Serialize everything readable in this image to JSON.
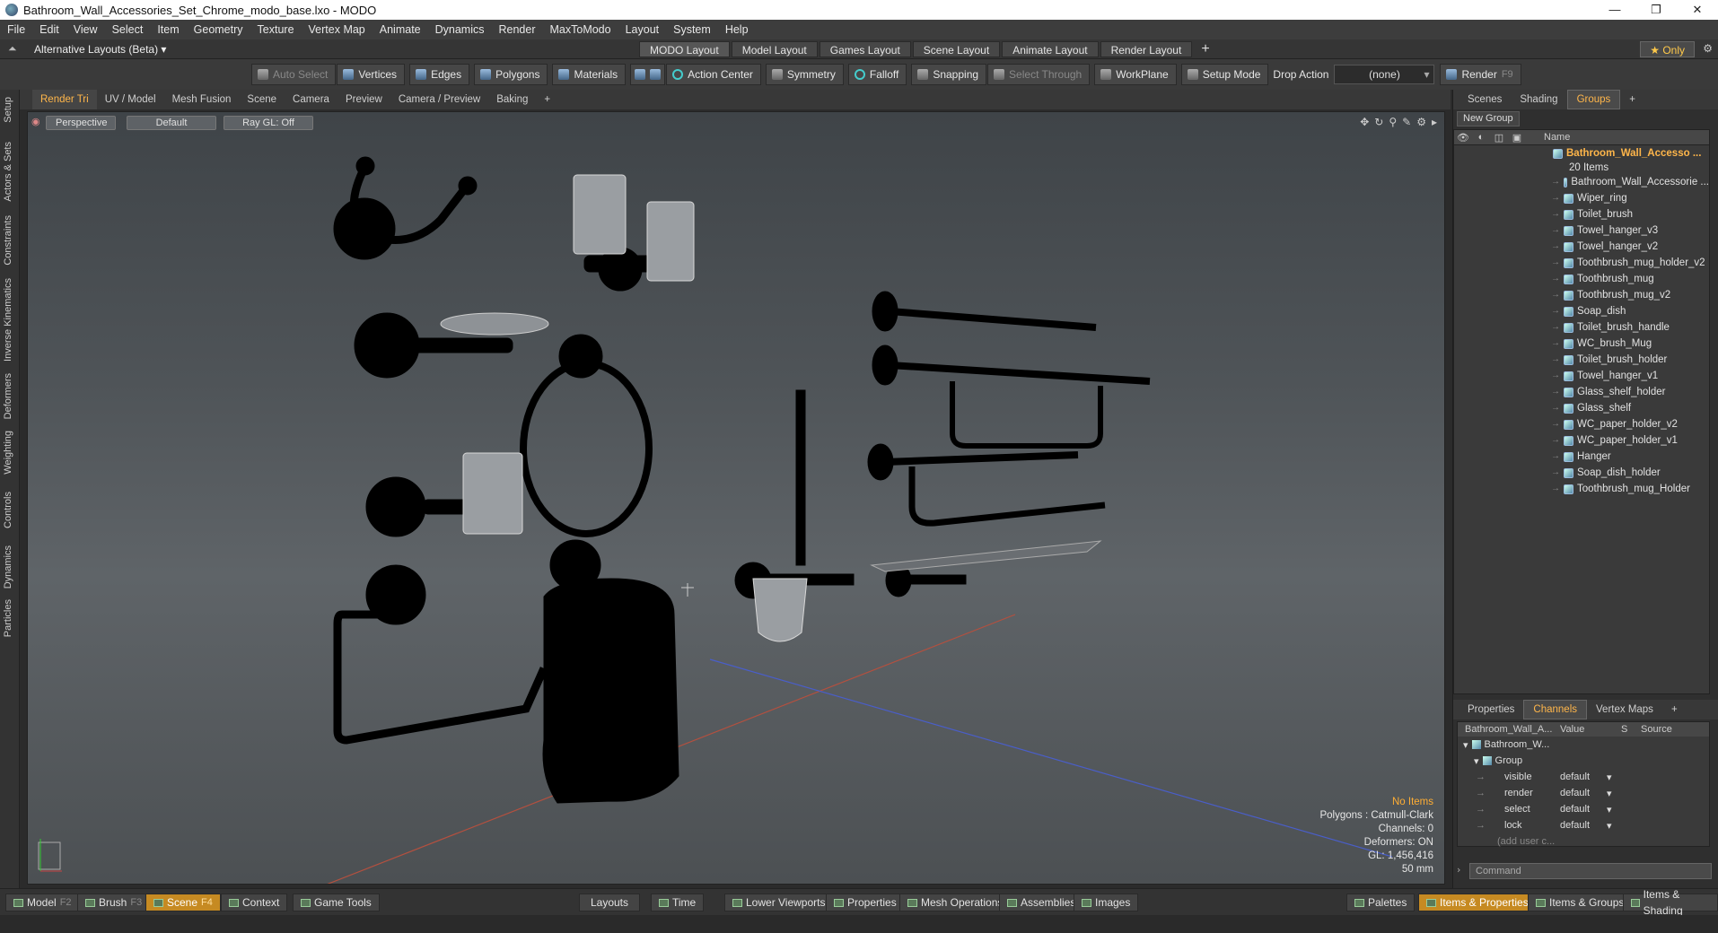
{
  "window": {
    "title": "Bathroom_Wall_Accessories_Set_Chrome_modo_base.lxo - MODO",
    "controls": [
      "—",
      "❐",
      "✕"
    ]
  },
  "menu": [
    "File",
    "Edit",
    "View",
    "Select",
    "Item",
    "Geometry",
    "Texture",
    "Vertex Map",
    "Animate",
    "Dynamics",
    "Render",
    "MaxToModo",
    "Layout",
    "System",
    "Help"
  ],
  "layoutbar": {
    "alt_layouts": "Alternative Layouts (Beta) ▾",
    "tabs": [
      "MODO Layout",
      "Model Layout",
      "Games Layout",
      "Scene Layout",
      "Animate Layout",
      "Render Layout"
    ],
    "plus": "+",
    "only": "★  Only"
  },
  "toolbar": {
    "auto_select": "Auto Select",
    "vertices": "Vertices",
    "edges": "Edges",
    "polygons": "Polygons",
    "materials": "Materials",
    "action_center": "Action Center",
    "symmetry": "Symmetry",
    "falloff": "Falloff",
    "snapping": "Snapping",
    "select_through": "Select Through",
    "workplane": "WorkPlane",
    "setup_mode": "Setup Mode",
    "drop_action": "Drop Action",
    "drop_value": "(none)",
    "render": "Render",
    "render_key": "F9"
  },
  "lefttabs": [
    "Setup",
    "Actors & Sets",
    "Constraints",
    "Inverse Kinematics",
    "Deformers",
    "Weighting",
    "Controls",
    "Dynamics",
    "Particles"
  ],
  "viewport": {
    "tabs": [
      "Render Tri",
      "UV / Model",
      "Mesh Fusion",
      "Scene",
      "Camera",
      "Preview",
      "Camera / Preview",
      "Baking",
      "+"
    ],
    "perspective": "Perspective",
    "default": "Default",
    "raygl": "Ray GL: Off",
    "info": {
      "selection": "No Items",
      "polygons": "Polygons : Catmull-Clark",
      "channels": "Channels: 0",
      "deformers": "Deformers: ON",
      "gl": "GL: 1,456,416",
      "scale": "50 mm"
    }
  },
  "scene_panel": {
    "tabs": [
      "Scenes",
      "Shading",
      "Groups",
      "+"
    ],
    "new_group": "New Group",
    "name_header": "Name",
    "root": "Bathroom_Wall_Accesso ...",
    "count": "20 Items",
    "items": [
      "Bathroom_Wall_Accessorie ...",
      "Wiper_ring",
      "Toilet_brush",
      "Towel_hanger_v3",
      "Towel_hanger_v2",
      "Toothbrush_mug_holder_v2",
      "Toothbrush_mug",
      "Toothbrush_mug_v2",
      "Soap_dish",
      "Toilet_brush_handle",
      "WC_brush_Mug",
      "Toilet_brush_holder",
      "Towel_hanger_v1",
      "Glass_shelf_holder",
      "Glass_shelf",
      "WC_paper_holder_v2",
      "WC_paper_holder_v1",
      "Hanger",
      "Soap_dish_holder",
      "Toothbrush_mug_Holder"
    ]
  },
  "channels_panel": {
    "tabs": [
      "Properties",
      "Channels",
      "Vertex Maps",
      "+"
    ],
    "headers": {
      "name": "Bathroom_Wall_A...",
      "value": "Value",
      "s": "S",
      "source": "Source"
    },
    "root": "Bathroom_W...",
    "group": "Group",
    "rows": [
      {
        "name": "visible",
        "value": "default"
      },
      {
        "name": "render",
        "value": "default"
      },
      {
        "name": "select",
        "value": "default"
      },
      {
        "name": "lock",
        "value": "default"
      }
    ],
    "add": "(add user c...",
    "command_placeholder": "Command"
  },
  "bottombar": {
    "model": "Model",
    "f2": "F2",
    "brush": "Brush",
    "f3": "F3",
    "scene": "Scene",
    "f4": "F4",
    "context": "Context",
    "game_tools": "Game Tools",
    "layouts": "Layouts",
    "time": "Time",
    "lower_viewports": "Lower Viewports",
    "properties": "Properties",
    "mesh_operations": "Mesh Operations",
    "assemblies": "Assemblies",
    "images": "Images",
    "palettes": "Palettes",
    "items_properties": "Items & Properties",
    "items_groups": "Items & Groups",
    "items_shading": "Items & Shading"
  },
  "colors": {
    "accent": "#ffb64a",
    "active_tab": "#c68a22"
  }
}
